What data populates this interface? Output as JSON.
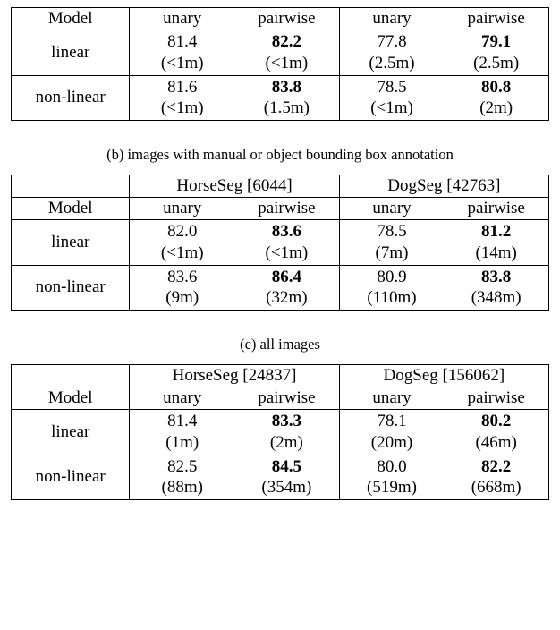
{
  "chart_data": [
    {
      "type": "table",
      "header_model": "Model",
      "columns": [
        "unary",
        "pairwise",
        "unary",
        "pairwise"
      ],
      "rows": [
        {
          "model": "linear",
          "cells": [
            {
              "value": "81.4",
              "time": "(<1m)",
              "bold": false
            },
            {
              "value": "82.2",
              "time": "(<1m)",
              "bold": true
            },
            {
              "value": "77.8",
              "time": "(2.5m)",
              "bold": false
            },
            {
              "value": "79.1",
              "time": "(2.5m)",
              "bold": true
            }
          ]
        },
        {
          "model": "non-linear",
          "cells": [
            {
              "value": "81.6",
              "time": "(<1m)",
              "bold": false
            },
            {
              "value": "83.8",
              "time": "(1.5m)",
              "bold": true
            },
            {
              "value": "78.5",
              "time": "(<1m)",
              "bold": false
            },
            {
              "value": "80.8",
              "time": "(2m)",
              "bold": true
            }
          ]
        }
      ]
    },
    {
      "type": "table",
      "caption": "(b) images with manual or object bounding box annotation",
      "datasets": [
        "HorseSeg [6044]",
        "DogSeg [42763]"
      ],
      "header_model": "Model",
      "columns": [
        "unary",
        "pairwise",
        "unary",
        "pairwise"
      ],
      "rows": [
        {
          "model": "linear",
          "cells": [
            {
              "value": "82.0",
              "time": "(<1m)",
              "bold": false
            },
            {
              "value": "83.6",
              "time": "(<1m)",
              "bold": true
            },
            {
              "value": "78.5",
              "time": "(7m)",
              "bold": false
            },
            {
              "value": "81.2",
              "time": "(14m)",
              "bold": true
            }
          ]
        },
        {
          "model": "non-linear",
          "cells": [
            {
              "value": "83.6",
              "time": "(9m)",
              "bold": false
            },
            {
              "value": "86.4",
              "time": "(32m)",
              "bold": true
            },
            {
              "value": "80.9",
              "time": "(110m)",
              "bold": false
            },
            {
              "value": "83.8",
              "time": "(348m)",
              "bold": true
            }
          ]
        }
      ]
    },
    {
      "type": "table",
      "caption": "(c) all images",
      "datasets": [
        "HorseSeg [24837]",
        "DogSeg [156062]"
      ],
      "header_model": "Model",
      "columns": [
        "unary",
        "pairwise",
        "unary",
        "pairwise"
      ],
      "rows": [
        {
          "model": "linear",
          "cells": [
            {
              "value": "81.4",
              "time": "(1m)",
              "bold": false
            },
            {
              "value": "83.3",
              "time": "(2m)",
              "bold": true
            },
            {
              "value": "78.1",
              "time": "(20m)",
              "bold": false
            },
            {
              "value": "80.2",
              "time": "(46m)",
              "bold": true
            }
          ]
        },
        {
          "model": "non-linear",
          "cells": [
            {
              "value": "82.5",
              "time": "(88m)",
              "bold": false
            },
            {
              "value": "84.5",
              "time": "(354m)",
              "bold": true
            },
            {
              "value": "80.0",
              "time": "(519m)",
              "bold": false
            },
            {
              "value": "82.2",
              "time": "(668m)",
              "bold": true
            }
          ]
        }
      ]
    }
  ]
}
